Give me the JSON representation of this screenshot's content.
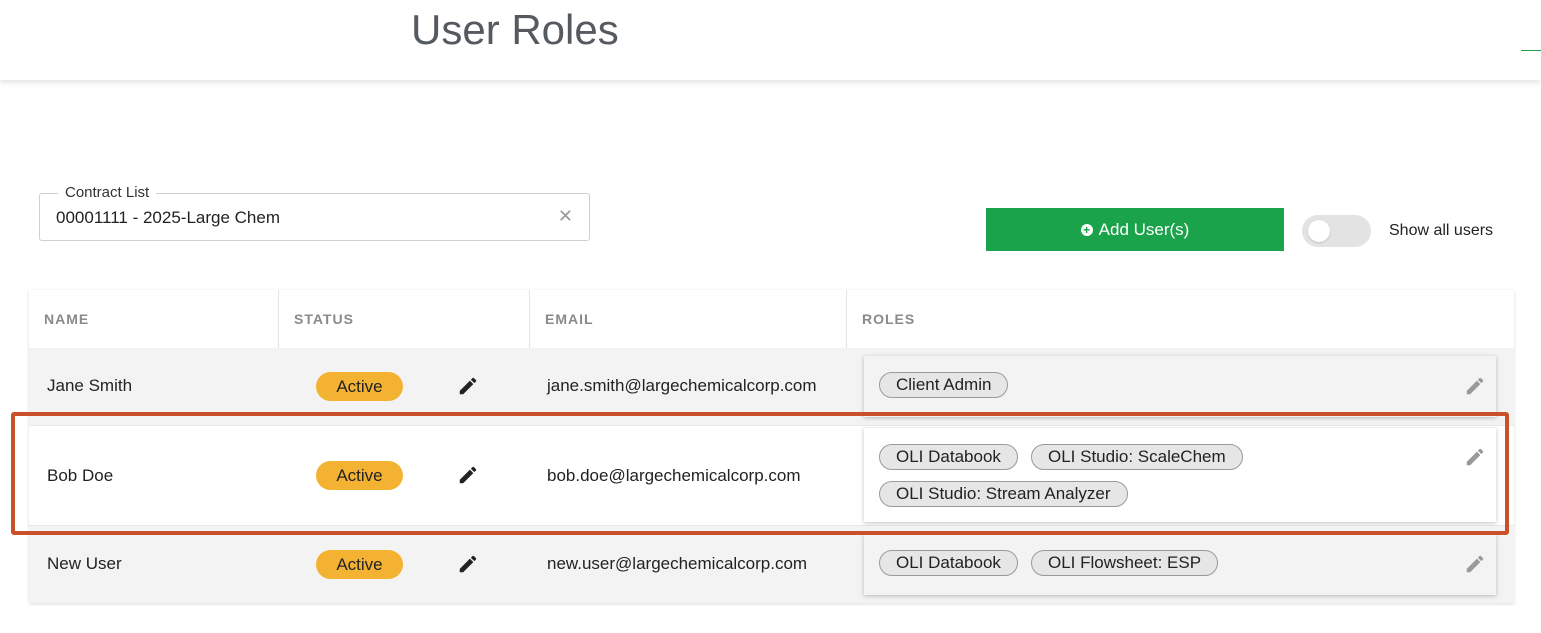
{
  "header": {
    "title": "User Roles"
  },
  "contract": {
    "label": "Contract List",
    "value": "00001111 - 2025-Large Chem",
    "clear_glyph": "✕"
  },
  "actions": {
    "add_users_label": "Add User(s)",
    "show_all_label": "Show all users",
    "show_all_enabled": false
  },
  "table": {
    "columns": [
      "NAME",
      "STATUS",
      "EMAIL",
      "ROLES"
    ],
    "rows": [
      {
        "name": "Jane Smith",
        "status": "Active",
        "email": "jane.smith@largechemicalcorp.com",
        "roles": [
          "Client Admin"
        ]
      },
      {
        "name": "Bob Doe",
        "status": "Active",
        "email": "bob.doe@largechemicalcorp.com",
        "roles": [
          "OLI Databook",
          "OLI Studio: ScaleChem",
          "OLI Studio: Stream Analyzer"
        ]
      },
      {
        "name": "New User",
        "status": "Active",
        "email": "new.user@largechemicalcorp.com",
        "roles": [
          "OLI Databook",
          "OLI Flowsheet: ESP"
        ]
      }
    ]
  },
  "colors": {
    "accent_green": "#1aa34a",
    "status_active": "#f4b233",
    "highlight": "#c8502b"
  },
  "icons": {
    "edit": "pencil-icon",
    "add": "plus-circle-icon",
    "clear": "close-icon"
  }
}
